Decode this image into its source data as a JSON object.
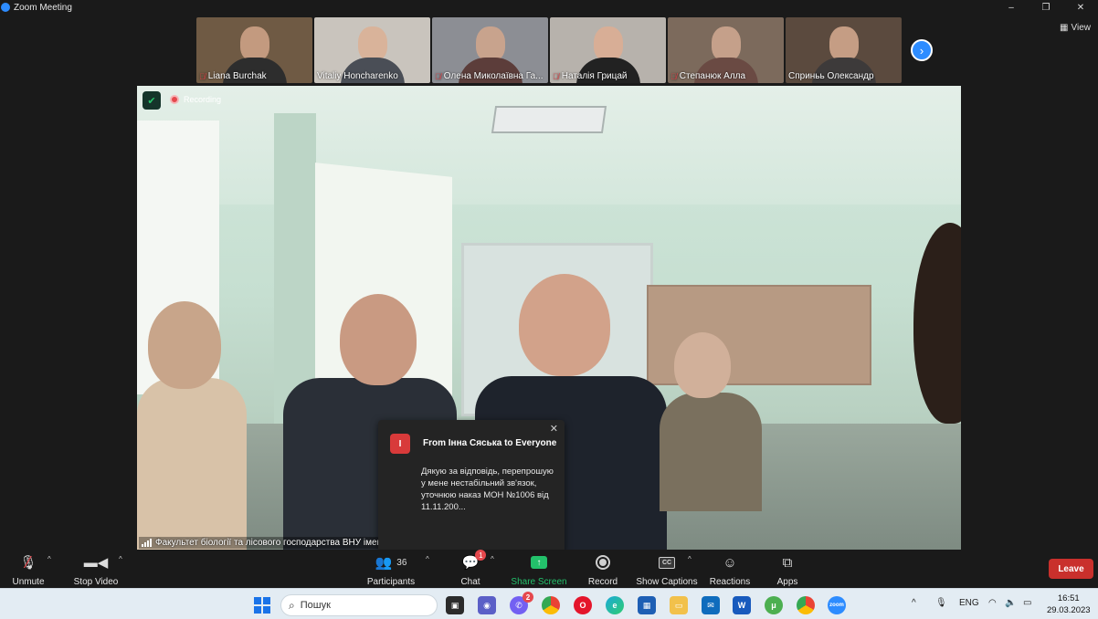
{
  "window": {
    "title": "Zoom Meeting",
    "controls": [
      "–",
      "❐",
      "✕"
    ]
  },
  "gallery": {
    "participants": [
      {
        "name": "Liana Burchak",
        "muted": true,
        "bg": "#6f5a44",
        "face": "#c39a7f",
        "body": "#2d2d2d"
      },
      {
        "name": "Vitaliy Honcharenko",
        "muted": false,
        "bg": "#c9c4bd",
        "face": "#d9b39a",
        "body": "#4a4e56"
      },
      {
        "name": "Олена Миколаївна Га...",
        "muted": true,
        "bg": "#8c8e94",
        "face": "#c8a38d",
        "body": "#5c3d3a"
      },
      {
        "name": "Наталія Грицай",
        "muted": true,
        "bg": "#b7b2ac",
        "face": "#d8ae96",
        "body": "#222"
      },
      {
        "name": "Степанюк Алла",
        "muted": true,
        "bg": "#7c6a5c",
        "face": "#c5a08a",
        "body": "#6a4a43"
      },
      {
        "name": "Сприньь Олександр",
        "muted": false,
        "bg": "#5b4a3e",
        "face": "#c59d84",
        "body": "#3d3a3a"
      }
    ],
    "view_label": "View"
  },
  "main_video": {
    "recording_label": "Recording",
    "participant_label": "Факультет біології та лісового господарства ВНУ імені Лесі Українки"
  },
  "chat_toast": {
    "avatar_letter": "І",
    "from": "From Інна Сяська to Everyone",
    "message": "Дякую за відповідь, перепрошую у мене нестабільний зв'язок, уточнюю наказ МОН №1006 від 11.11.200..."
  },
  "toolbar": {
    "unmute": "Unmute",
    "stop_video": "Stop Video",
    "participants": "Participants",
    "participants_count": "36",
    "chat": "Chat",
    "chat_badge": "1",
    "share_screen": "Share Screen",
    "record": "Record",
    "show_captions": "Show Captions",
    "reactions": "Reactions",
    "apps": "Apps",
    "leave": "Leave",
    "share_color": "#23c16b",
    "leave_color": "#c9302c"
  },
  "taskbar": {
    "search_placeholder": "Пошук",
    "viber_badge": "2",
    "lang": "ENG",
    "time": "16:51",
    "date": "29.03.2023"
  }
}
